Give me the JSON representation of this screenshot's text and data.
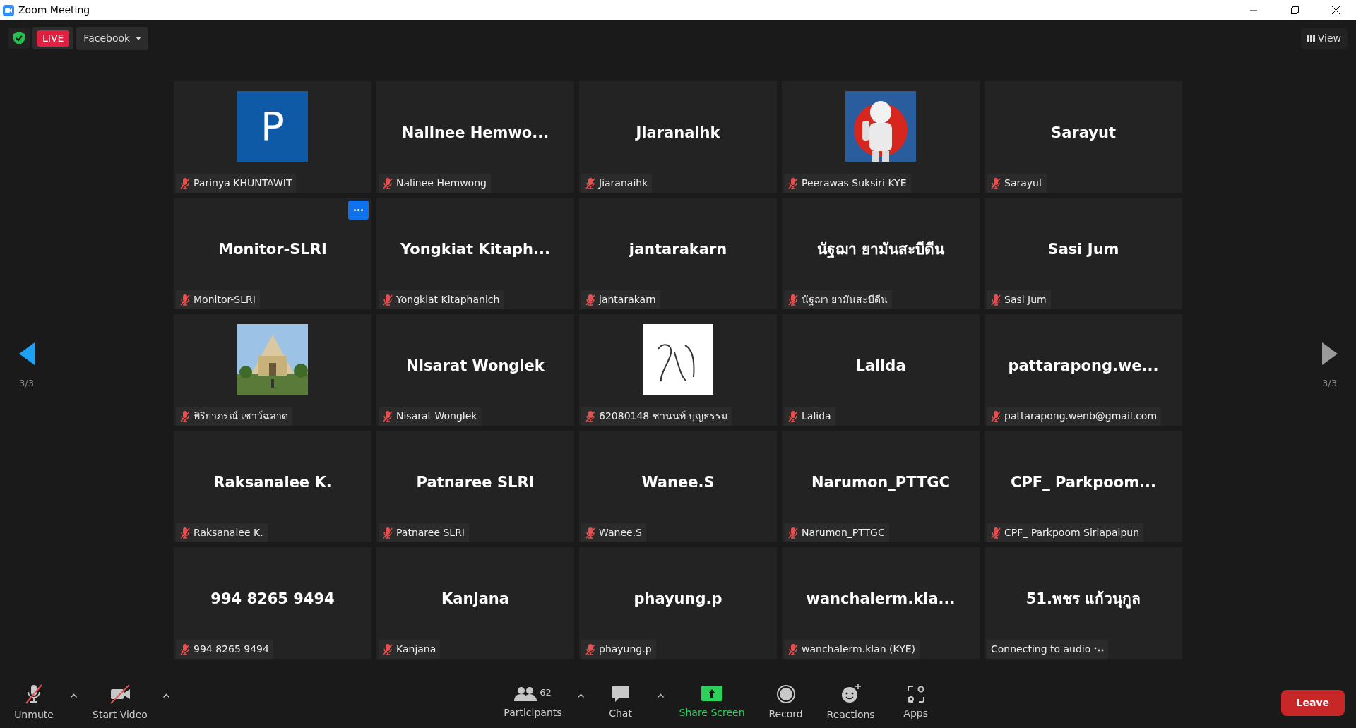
{
  "window": {
    "title": "Zoom Meeting"
  },
  "top_bar": {
    "live": "LIVE",
    "stream_target": "Facebook",
    "view": "View"
  },
  "page_nav": {
    "previous": {
      "label": "3/3",
      "disabled": false
    },
    "next": {
      "label": "3/3",
      "disabled": true
    }
  },
  "tiles": [
    {
      "kind": "avatar",
      "initial": "P",
      "name": "Parinya KHUNTAWIT",
      "muted": true,
      "hovered": false
    },
    {
      "kind": "name",
      "display": "Nalinee  Hemwo...",
      "name": "Nalinee Hemwong",
      "muted": true,
      "hovered": false
    },
    {
      "kind": "name",
      "display": "Jiaranaihk",
      "name": "Jiaranaihk",
      "muted": true,
      "hovered": false
    },
    {
      "kind": "picture",
      "name": "Peerawas Suksiri KYE",
      "muted": true,
      "hovered": false
    },
    {
      "kind": "name",
      "display": "Sarayut",
      "name": "Sarayut",
      "muted": true,
      "hovered": false
    },
    {
      "kind": "name",
      "display": "Monitor-SLRI",
      "name": "Monitor-SLRI",
      "muted": true,
      "hovered": true
    },
    {
      "kind": "name",
      "display": "Yongkiat  Kitaph...",
      "name": "Yongkiat Kitaphanich",
      "muted": true,
      "hovered": false
    },
    {
      "kind": "name",
      "display": "jantarakarn",
      "name": "jantarakarn",
      "muted": true,
      "hovered": false
    },
    {
      "kind": "name",
      "display": "นัฐฌา ยามันสะบีดีน",
      "name": "นัฐฌา ยามันสะบีดีน",
      "muted": true,
      "hovered": false
    },
    {
      "kind": "name",
      "display": "Sasi Jum",
      "name": "Sasi Jum",
      "muted": true,
      "hovered": false
    },
    {
      "kind": "picture",
      "name": "พิริยาภรณ์ เชาว์ฉลาด",
      "muted": true,
      "hovered": false
    },
    {
      "kind": "name",
      "display": "Nisarat Wonglek",
      "name": "Nisarat Wonglek",
      "muted": true,
      "hovered": false
    },
    {
      "kind": "picture",
      "name": "62080148 ชานนท์ บุญธรรม",
      "muted": true,
      "hovered": false
    },
    {
      "kind": "name",
      "display": "Lalida",
      "name": "Lalida",
      "muted": true,
      "hovered": false
    },
    {
      "kind": "name",
      "display": "pattarapong.we...",
      "name": "pattarapong.wenb@gmail.com",
      "muted": true,
      "hovered": false
    },
    {
      "kind": "name",
      "display": "Raksanalee K.",
      "name": "Raksanalee K.",
      "muted": true,
      "hovered": false
    },
    {
      "kind": "name",
      "display": "Patnaree SLRI",
      "name": "Patnaree SLRI",
      "muted": true,
      "hovered": false
    },
    {
      "kind": "name",
      "display": "Wanee.S",
      "name": "Wanee.S",
      "muted": true,
      "hovered": false
    },
    {
      "kind": "name",
      "display": "Narumon_PTTGC",
      "name": "Narumon_PTTGC",
      "muted": true,
      "hovered": false
    },
    {
      "kind": "name",
      "display": "CPF_ Parkpoom...",
      "name": "CPF_ Parkpoom Siriapaipun",
      "muted": true,
      "hovered": false
    },
    {
      "kind": "name",
      "display": "994 8265 9494",
      "name": "994 8265 9494",
      "muted": true,
      "hovered": false
    },
    {
      "kind": "name",
      "display": "Kanjana",
      "name": "Kanjana",
      "muted": true,
      "hovered": false
    },
    {
      "kind": "name",
      "display": "phayung.p",
      "name": "phayung.p",
      "muted": true,
      "hovered": false
    },
    {
      "kind": "name",
      "display": "wanchalerm.kla...",
      "name": "wanchalerm.klan (KYE)",
      "muted": true,
      "hovered": false
    },
    {
      "kind": "name",
      "display": "51.พชร แก้วนุกูล",
      "name": "Connecting to audio",
      "muted": false,
      "hovered": false
    }
  ],
  "toolbar": {
    "left": [
      {
        "kind": "mic",
        "label": "Unmute",
        "off": true,
        "has_menu": true
      },
      {
        "kind": "video",
        "label": "Start Video",
        "off": true,
        "has_menu": true
      }
    ],
    "center": [
      {
        "kind": "participants",
        "label": "Participants",
        "count": "62",
        "has_menu": true
      },
      {
        "kind": "chat",
        "label": "Chat",
        "has_menu": true
      },
      {
        "kind": "share",
        "label": "Share Screen",
        "has_menu": false
      },
      {
        "kind": "record",
        "label": "Record",
        "has_menu": false
      },
      {
        "kind": "reactions",
        "label": "Reactions",
        "has_menu": false
      },
      {
        "kind": "apps",
        "label": "Apps",
        "has_menu": false
      }
    ],
    "leave": "Leave"
  }
}
